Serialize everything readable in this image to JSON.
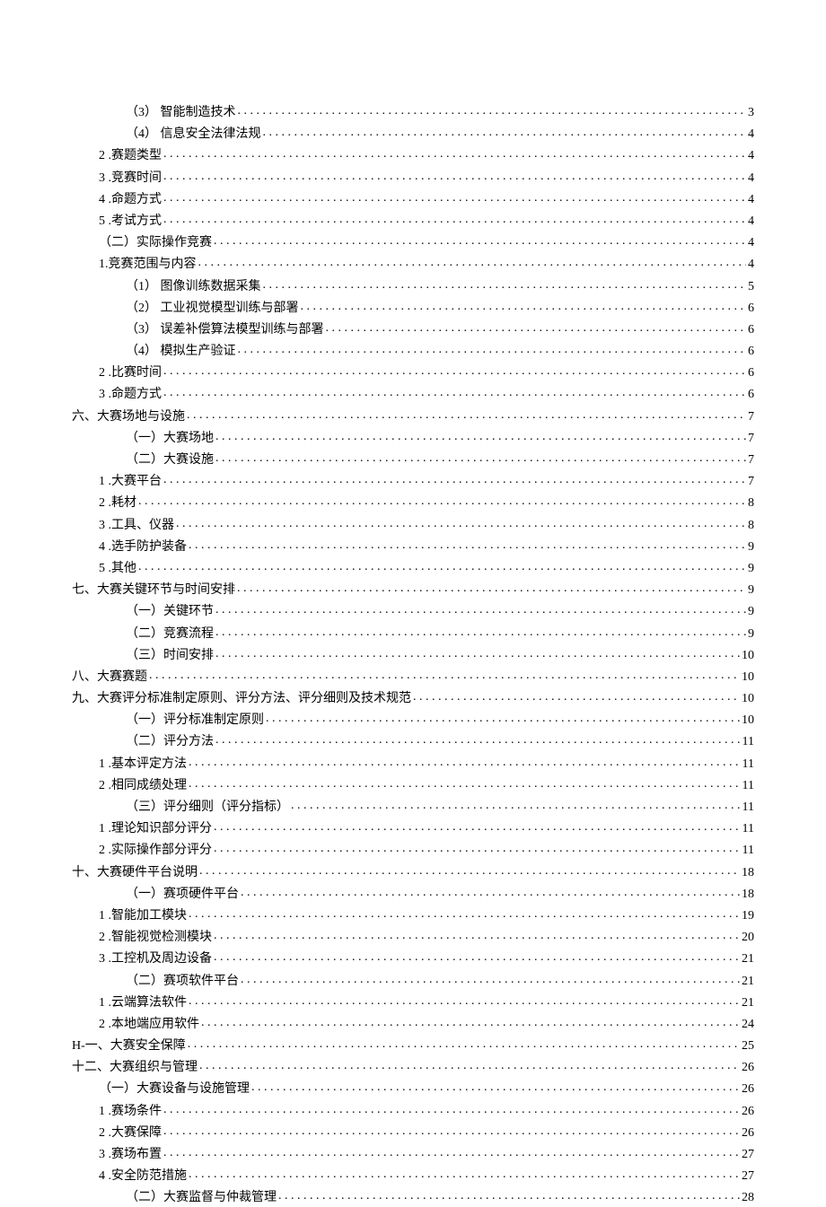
{
  "toc": [
    {
      "indent": 3,
      "label": "（3） 智能制造技术",
      "page": "3"
    },
    {
      "indent": 3,
      "label": "（4） 信息安全法律法规",
      "page": "4"
    },
    {
      "indent": 1,
      "label": "2  .赛题类型",
      "page": "4"
    },
    {
      "indent": 1,
      "label": "3  .竞赛时间",
      "page": "4"
    },
    {
      "indent": 1,
      "label": "4  .命题方式",
      "page": "4"
    },
    {
      "indent": 1,
      "label": "5  .考试方式",
      "page": "4"
    },
    {
      "indent": 1,
      "label": "（二）实际操作竞赛",
      "page": "4"
    },
    {
      "indent": 1,
      "label": "1.竞赛范围与内容",
      "page": "4"
    },
    {
      "indent": 3,
      "label": "（1） 图像训练数据采集",
      "page": "5"
    },
    {
      "indent": 3,
      "label": "（2） 工业视觉模型训练与部署",
      "page": "6"
    },
    {
      "indent": 3,
      "label": "（3） 误差补偿算法模型训练与部署",
      "page": "6"
    },
    {
      "indent": 3,
      "label": "（4） 模拟生产验证",
      "page": "6"
    },
    {
      "indent": 1,
      "label": "2  .比赛时间",
      "page": "6"
    },
    {
      "indent": 1,
      "label": "3  .命题方式",
      "page": "6"
    },
    {
      "indent": 0,
      "label": "六、大赛场地与设施",
      "page": "7"
    },
    {
      "indent": 2,
      "label": "（一）大赛场地",
      "page": "7"
    },
    {
      "indent": 2,
      "label": "（二）大赛设施",
      "page": "7"
    },
    {
      "indent": 1,
      "label": "1  .大赛平台",
      "page": "7"
    },
    {
      "indent": 1,
      "label": "2  .耗材",
      "page": "8"
    },
    {
      "indent": 1,
      "label": "3  .工具、仪器",
      "page": "8"
    },
    {
      "indent": 1,
      "label": "4  .选手防护装备",
      "page": "9"
    },
    {
      "indent": 1,
      "label": "5  .其他",
      "page": "9"
    },
    {
      "indent": 0,
      "label": "七、大赛关键环节与时间安排",
      "page": "9"
    },
    {
      "indent": 2,
      "label": "（一）关键环节",
      "page": "9"
    },
    {
      "indent": 2,
      "label": "（二）竞赛流程",
      "page": "9"
    },
    {
      "indent": 2,
      "label": "（三）时间安排",
      "page": "10"
    },
    {
      "indent": 0,
      "label": "八、大赛赛题",
      "page": "10"
    },
    {
      "indent": 0,
      "label": "九、大赛评分标准制定原则、评分方法、评分细则及技术规范",
      "page": "10"
    },
    {
      "indent": 2,
      "label": "（一）评分标准制定原则",
      "page": "10"
    },
    {
      "indent": 2,
      "label": "（二）评分方法",
      "page": "11"
    },
    {
      "indent": 1,
      "label": "1  .基本评定方法",
      "page": "11"
    },
    {
      "indent": 1,
      "label": "2  .相同成绩处理",
      "page": "11"
    },
    {
      "indent": 2,
      "label": "（三）评分细则（评分指标）",
      "page": "11"
    },
    {
      "indent": 1,
      "label": "1  .理论知识部分评分",
      "page": "11"
    },
    {
      "indent": 1,
      "label": "2  .实际操作部分评分",
      "page": "11"
    },
    {
      "indent": 0,
      "label": "十、大赛硬件平台说明",
      "page": "18"
    },
    {
      "indent": 2,
      "label": "（一）赛项硬件平台",
      "page": "18"
    },
    {
      "indent": 1,
      "label": "1  .智能加工模块",
      "page": "19"
    },
    {
      "indent": 1,
      "label": "2  .智能视觉检测模块",
      "page": "20"
    },
    {
      "indent": 1,
      "label": "3  .工控机及周边设备",
      "page": "21"
    },
    {
      "indent": 2,
      "label": "（二）赛项软件平台",
      "page": "21"
    },
    {
      "indent": 1,
      "label": "1  .云端算法软件",
      "page": "21"
    },
    {
      "indent": 1,
      "label": "2  .本地端应用软件",
      "page": "24"
    },
    {
      "indent": 0,
      "label": "H-一、大赛安全保障",
      "page": "25"
    },
    {
      "indent": 0,
      "label": "十二、大赛组织与管理",
      "page": "26"
    },
    {
      "indent": 1,
      "label": "（一）大赛设备与设施管理",
      "page": "26"
    },
    {
      "indent": 1,
      "label": "1  .赛场条件",
      "page": "26"
    },
    {
      "indent": 1,
      "label": "2  .大赛保障",
      "page": "26"
    },
    {
      "indent": 1,
      "label": "3  .赛场布置",
      "page": "27"
    },
    {
      "indent": 1,
      "label": "4  .安全防范措施",
      "page": "27"
    },
    {
      "indent": 2,
      "label": "（二）大赛监督与仲裁管理",
      "page": "28"
    }
  ]
}
